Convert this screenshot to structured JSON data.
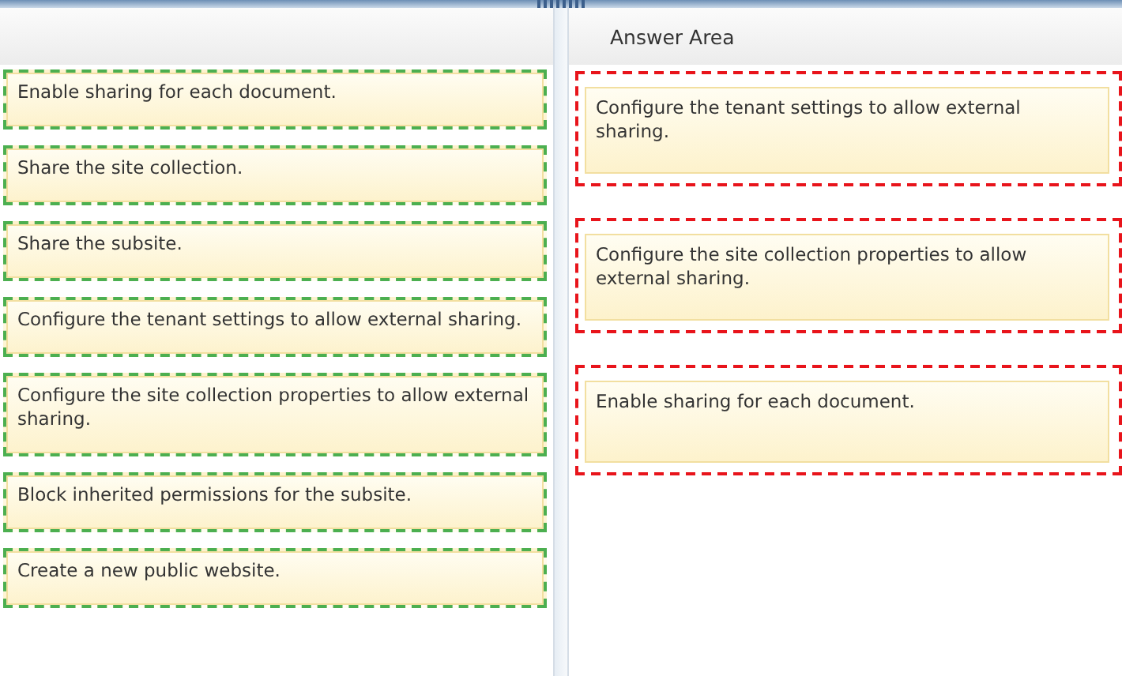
{
  "choices": [
    {
      "text": "Enable sharing for each document."
    },
    {
      "text": "Share the site collection."
    },
    {
      "text": "Share the subsite."
    },
    {
      "text": "Configure the tenant settings to allow external sharing."
    },
    {
      "text": "Configure the site collection properties to allow external sharing."
    },
    {
      "text": "Block inherited permissions for the subsite."
    },
    {
      "text": "Create a new public website."
    }
  ],
  "answer_area": {
    "title": "Answer Area",
    "slots": [
      {
        "text": "Configure the tenant settings to allow external sharing."
      },
      {
        "text": "Configure the site collection properties to allow external sharing."
      },
      {
        "text": "Enable sharing for each document."
      }
    ]
  }
}
